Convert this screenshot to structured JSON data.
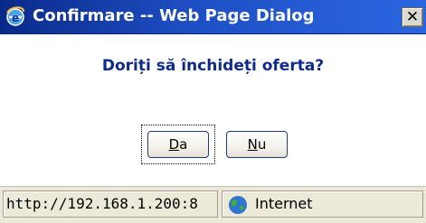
{
  "window": {
    "title": "Confirmare -- Web Page Dialog",
    "app_icon": "internet-explorer-icon",
    "close_glyph": "✕"
  },
  "dialog": {
    "question": "Doriți să închideți oferta?",
    "buttons": {
      "yes": {
        "underlined": "D",
        "rest": "a"
      },
      "no": {
        "underlined": "N",
        "rest": "u"
      }
    }
  },
  "statusbar": {
    "url": "http://192.168.1.200:8",
    "zone_icon": "globe-icon",
    "zone_label": "Internet"
  },
  "colors": {
    "titlebar": "#1e4fc4",
    "question_text": "#102a8c",
    "statusbar": "#ece9d8"
  }
}
